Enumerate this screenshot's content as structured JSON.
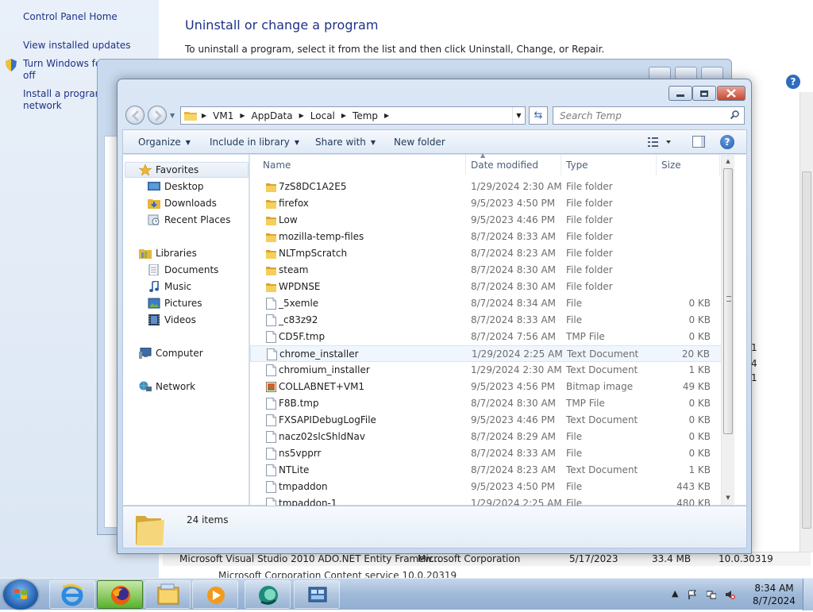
{
  "control_panel": {
    "sidebar": {
      "home": "Control Panel Home",
      "installed_updates": "View installed updates",
      "features_line1": "Turn Windows fea",
      "features_line2": "off",
      "install_line1": "Install a program",
      "install_line2": "network"
    },
    "title": "Uninstall or change a program",
    "description": "To uninstall a program, select it from the list and then click Uninstall, Change, or Repair.",
    "help": "?",
    "bottom_row": {
      "name": "Microsoft Visual Studio 2010 ADO.NET Entity Framew...",
      "publisher": "Microsoft Corporation",
      "installed_on": "5/17/2023",
      "size": "33.4 MB",
      "version": "10.0.30319"
    },
    "partial_row": "Microsoft Corporation   Content service   10.0.20319",
    "right_digits": [
      "1",
      "4",
      "1"
    ]
  },
  "explorer": {
    "breadcrumb": [
      "VM1",
      "AppData",
      "Local",
      "Temp"
    ],
    "search_placeholder": "Search Temp",
    "toolbar": {
      "organize": "Organize",
      "include_in_library": "Include in library",
      "share_with": "Share with",
      "new_folder": "New folder",
      "help": "?"
    },
    "nav": {
      "favorites": "Favorites",
      "desktop": "Desktop",
      "downloads": "Downloads",
      "recent_places": "Recent Places",
      "libraries": "Libraries",
      "documents": "Documents",
      "music": "Music",
      "pictures": "Pictures",
      "videos": "Videos",
      "computer": "Computer",
      "network": "Network"
    },
    "columns": {
      "name": "Name",
      "date_modified": "Date modified",
      "type": "Type",
      "size": "Size"
    },
    "files": [
      {
        "name": "7zS8DC1A2E5",
        "date": "1/29/2024 2:30 AM",
        "type": "File folder",
        "size": "",
        "icon": "folder-icon"
      },
      {
        "name": "firefox",
        "date": "9/5/2023 4:50 PM",
        "type": "File folder",
        "size": "",
        "icon": "folder-icon"
      },
      {
        "name": "Low",
        "date": "9/5/2023 4:46 PM",
        "type": "File folder",
        "size": "",
        "icon": "folder-icon"
      },
      {
        "name": "mozilla-temp-files",
        "date": "8/7/2024 8:33 AM",
        "type": "File folder",
        "size": "",
        "icon": "folder-icon"
      },
      {
        "name": "NLTmpScratch",
        "date": "8/7/2024 8:23 AM",
        "type": "File folder",
        "size": "",
        "icon": "folder-icon"
      },
      {
        "name": "steam",
        "date": "8/7/2024 8:30 AM",
        "type": "File folder",
        "size": "",
        "icon": "folder-icon"
      },
      {
        "name": "WPDNSE",
        "date": "8/7/2024 8:30 AM",
        "type": "File folder",
        "size": "",
        "icon": "folder-icon"
      },
      {
        "name": "_5xemle",
        "date": "8/7/2024 8:34 AM",
        "type": "File",
        "size": "0 KB",
        "icon": "file-icon"
      },
      {
        "name": "_c83z92",
        "date": "8/7/2024 8:33 AM",
        "type": "File",
        "size": "0 KB",
        "icon": "file-icon"
      },
      {
        "name": "CD5F.tmp",
        "date": "8/7/2024 7:56 AM",
        "type": "TMP File",
        "size": "0 KB",
        "icon": "file-icon"
      },
      {
        "name": "chrome_installer",
        "date": "1/29/2024 2:25 AM",
        "type": "Text Document",
        "size": "20 KB",
        "icon": "text-file-icon"
      },
      {
        "name": "chromium_installer",
        "date": "1/29/2024 2:30 AM",
        "type": "Text Document",
        "size": "1 KB",
        "icon": "text-file-icon"
      },
      {
        "name": "COLLABNET+VM1",
        "date": "9/5/2023 4:56 PM",
        "type": "Bitmap image",
        "size": "49 KB",
        "icon": "bitmap-icon"
      },
      {
        "name": "F8B.tmp",
        "date": "8/7/2024 8:30 AM",
        "type": "TMP File",
        "size": "0 KB",
        "icon": "file-icon"
      },
      {
        "name": "FXSAPIDebugLogFile",
        "date": "9/5/2023 4:46 PM",
        "type": "Text Document",
        "size": "0 KB",
        "icon": "text-file-icon"
      },
      {
        "name": "nacz02slcShldNav",
        "date": "8/7/2024 8:29 AM",
        "type": "File",
        "size": "0 KB",
        "icon": "file-icon"
      },
      {
        "name": "ns5vpprr",
        "date": "8/7/2024 8:33 AM",
        "type": "File",
        "size": "0 KB",
        "icon": "file-icon"
      },
      {
        "name": "NTLite",
        "date": "8/7/2024 8:23 AM",
        "type": "Text Document",
        "size": "1 KB",
        "icon": "text-file-icon"
      },
      {
        "name": "tmpaddon",
        "date": "9/5/2023 4:50 PM",
        "type": "File",
        "size": "443 KB",
        "icon": "file-icon"
      },
      {
        "name": "tmpaddon-1",
        "date": "1/29/2024 2:25 AM",
        "type": "File",
        "size": "480 KB",
        "icon": "file-icon"
      }
    ],
    "hovered_file": "chrome_installer",
    "item_count": "24 items"
  },
  "taskbar": {
    "apps": [
      "internet-explorer-icon",
      "firefox-icon",
      "file-explorer-icon",
      "media-player-icon",
      "app-icon",
      "control-panel-icon"
    ],
    "active_app": "firefox-icon",
    "time": "8:34 AM",
    "date": "8/7/2024"
  },
  "colors": {
    "link": "#1e3287",
    "window_frame": "#c5d7ee",
    "close_button": "#c7472f",
    "taskbar": "#9fb9d8",
    "folder": "#f2c75c"
  }
}
